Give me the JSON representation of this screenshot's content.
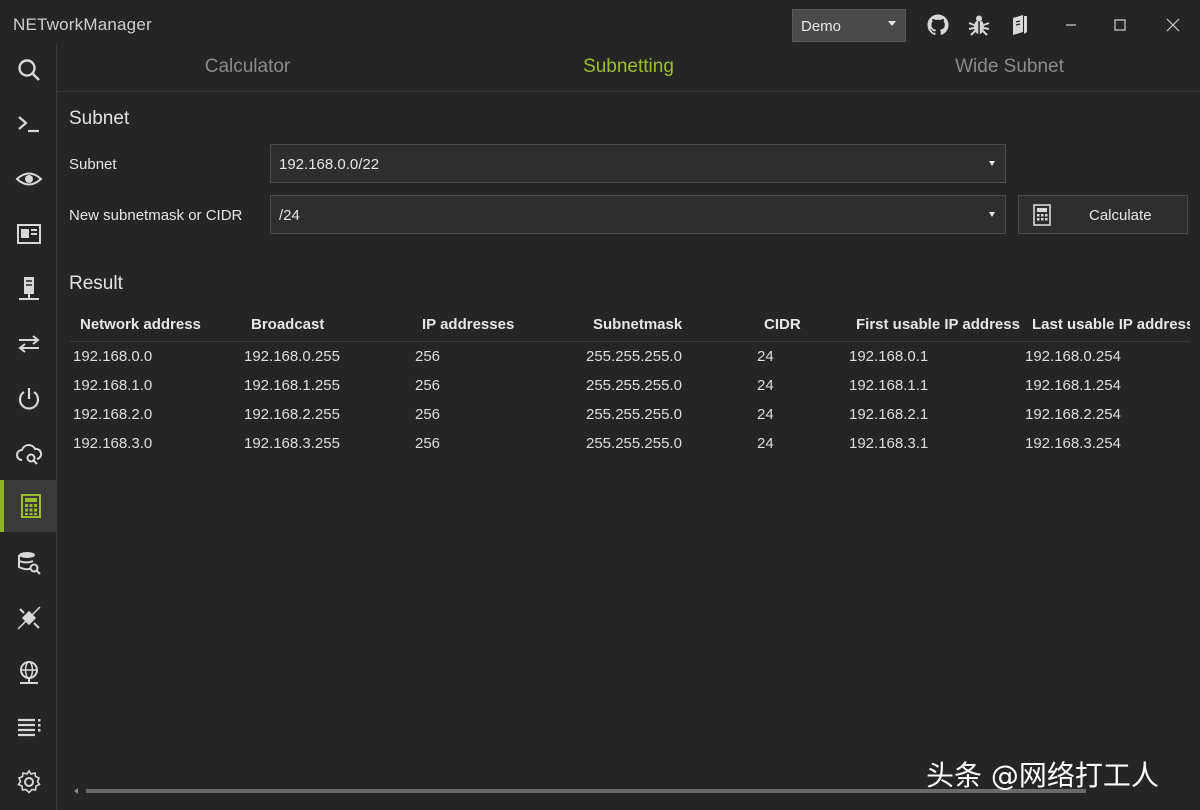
{
  "app": {
    "title": "NETworkManager"
  },
  "profile": {
    "selected": "Demo"
  },
  "titlebar_icons": [
    "github-icon",
    "bug-icon",
    "book-icon"
  ],
  "window_buttons": [
    "minimize-icon",
    "maximize-icon",
    "close-icon"
  ],
  "sidebar": {
    "items": [
      {
        "name": "search",
        "icon": "search-icon"
      },
      {
        "name": "terminal",
        "icon": "terminal-icon"
      },
      {
        "name": "view",
        "icon": "eye-icon"
      },
      {
        "name": "dashboard",
        "icon": "card-icon"
      },
      {
        "name": "server",
        "icon": "server-icon"
      },
      {
        "name": "transfer",
        "icon": "arrows-icon"
      },
      {
        "name": "power",
        "icon": "power-icon"
      },
      {
        "name": "cloud-search",
        "icon": "cloud-search-icon"
      },
      {
        "name": "subnet-calculator",
        "icon": "calculator-icon",
        "active": true
      },
      {
        "name": "database-search",
        "icon": "database-search-icon"
      },
      {
        "name": "disconnect",
        "icon": "plug-off-icon"
      },
      {
        "name": "network",
        "icon": "globe-network-icon"
      },
      {
        "name": "list",
        "icon": "list-icon"
      },
      {
        "name": "settings",
        "icon": "gear-icon"
      }
    ]
  },
  "tabs": [
    {
      "label": "Calculator",
      "active": false
    },
    {
      "label": "Subnetting",
      "active": true
    },
    {
      "label": "Wide Subnet",
      "active": false
    }
  ],
  "subnet_section": {
    "title": "Subnet",
    "subnet_label": "Subnet",
    "subnet_value": "192.168.0.0/22",
    "cidr_label": "New subnetmask or CIDR",
    "cidr_value": "/24",
    "calculate_label": "Calculate"
  },
  "result": {
    "title": "Result",
    "columns": [
      "Network address",
      "Broadcast",
      "IP addresses",
      "Subnetmask",
      "CIDR",
      "First usable IP address",
      "Last usable IP address"
    ],
    "rows": [
      [
        "192.168.0.0",
        "192.168.0.255",
        "256",
        "255.255.255.0",
        "24",
        "192.168.0.1",
        "192.168.0.254"
      ],
      [
        "192.168.1.0",
        "192.168.1.255",
        "256",
        "255.255.255.0",
        "24",
        "192.168.1.1",
        "192.168.1.254"
      ],
      [
        "192.168.2.0",
        "192.168.2.255",
        "256",
        "255.255.255.0",
        "24",
        "192.168.2.1",
        "192.168.2.254"
      ],
      [
        "192.168.3.0",
        "192.168.3.255",
        "256",
        "255.255.255.0",
        "24",
        "192.168.3.1",
        "192.168.3.254"
      ]
    ]
  },
  "colors": {
    "accent": "#9bbf2a",
    "background": "#252525"
  },
  "watermark": "头条 @网络打工人"
}
